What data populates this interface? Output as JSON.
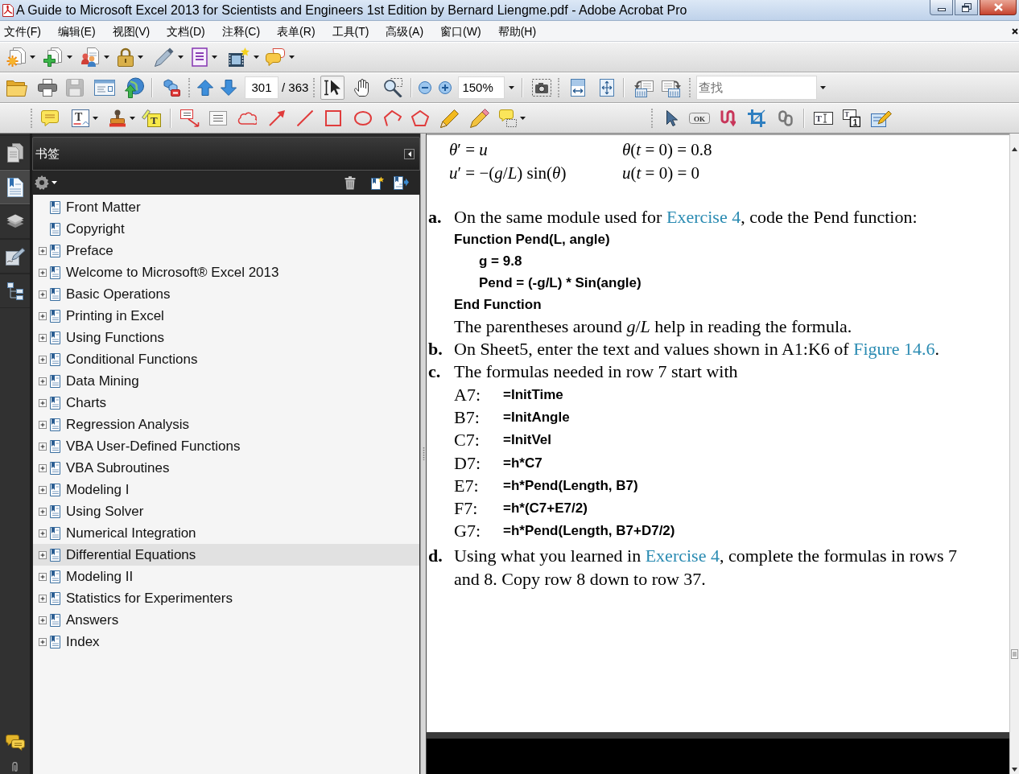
{
  "window": {
    "title": "A Guide to Microsoft Excel 2013 for Scientists and Engineers 1st Edition by Bernard Liengme.pdf - Adobe Acrobat Pro"
  },
  "menu_bar": {
    "items": [
      "文件(F)",
      "编辑(E)",
      "视图(V)",
      "文档(D)",
      "注释(C)",
      "表单(R)",
      "工具(T)",
      "高级(A)",
      "窗口(W)",
      "帮助(H)"
    ]
  },
  "task_toolbar": {
    "buttons": [
      {
        "kind": "create"
      },
      {
        "kind": "combine"
      },
      {
        "kind": "collaborate"
      },
      {
        "kind": "secure"
      },
      {
        "kind": "sign"
      },
      {
        "kind": "forms"
      },
      {
        "kind": "multimedia"
      },
      {
        "kind": "comment"
      }
    ]
  },
  "file_toolbar": {
    "buttons": [
      {
        "kind": "open",
        "disabled": false
      },
      {
        "kind": "print",
        "disabled": false
      },
      {
        "kind": "save",
        "disabled": true
      },
      {
        "kind": "email",
        "disabled": false
      },
      {
        "kind": "upload",
        "disabled": false
      }
    ]
  },
  "page_navigation": {
    "page": "301",
    "page_count": "/ 363"
  },
  "select_zoom_tools": {
    "tools": [
      {
        "kind": "select",
        "selected": true
      },
      {
        "kind": "hand",
        "selected": false
      },
      {
        "kind": "marquee_zoom",
        "selected": false
      }
    ],
    "zoom": "150%"
  },
  "search": {
    "placeholder": "查找"
  },
  "comment_toolbar": {
    "text_edits_glyph": "T",
    "highlight_glyph": "T"
  },
  "forms_toolbar": {
    "button_glyph": "OK",
    "text_field_glyph": "T",
    "list_box_glyphs": [
      "T",
      "1"
    ]
  },
  "navigation_pane": {
    "buttons": [
      {
        "kind": "pages",
        "selected": false
      },
      {
        "kind": "bookmarks",
        "selected": true
      },
      {
        "kind": "layers",
        "selected": false
      },
      {
        "kind": "signatures",
        "selected": false
      },
      {
        "kind": "model_tree",
        "selected": false
      }
    ]
  },
  "bookmarks_panel": {
    "title": "书签",
    "items": [
      {
        "label": "Front Matter",
        "expandable": false,
        "selected": false
      },
      {
        "label": "Copyright",
        "expandable": false,
        "selected": false
      },
      {
        "label": "Preface",
        "expandable": true,
        "expanded": false,
        "selected": false
      },
      {
        "label": "Welcome to Microsoft® Excel 2013",
        "expandable": true,
        "expanded": false,
        "selected": false
      },
      {
        "label": "Basic Operations",
        "expandable": true,
        "expanded": false,
        "selected": false
      },
      {
        "label": "Printing in Excel",
        "expandable": true,
        "expanded": false,
        "selected": false
      },
      {
        "label": "Using Functions",
        "expandable": true,
        "expanded": false,
        "selected": false
      },
      {
        "label": "Conditional Functions",
        "expandable": true,
        "expanded": false,
        "selected": false
      },
      {
        "label": "Data Mining",
        "expandable": true,
        "expanded": false,
        "selected": false
      },
      {
        "label": "Charts",
        "expandable": true,
        "expanded": false,
        "selected": false
      },
      {
        "label": "Regression Analysis",
        "expandable": true,
        "expanded": false,
        "selected": false
      },
      {
        "label": "VBA User-Defined Functions",
        "expandable": true,
        "expanded": false,
        "selected": false
      },
      {
        "label": "VBA Subroutines",
        "expandable": true,
        "expanded": false,
        "selected": false
      },
      {
        "label": "Modeling I",
        "expandable": true,
        "expanded": false,
        "selected": false
      },
      {
        "label": "Using Solver",
        "expandable": true,
        "expanded": false,
        "selected": false
      },
      {
        "label": "Numerical Integration",
        "expandable": true,
        "expanded": false,
        "selected": false
      },
      {
        "label": "Differential Equations",
        "expandable": true,
        "expanded": false,
        "selected": true
      },
      {
        "label": "Modeling II",
        "expandable": true,
        "expanded": false,
        "selected": false
      },
      {
        "label": "Statistics for Experimenters",
        "expandable": true,
        "expanded": false,
        "selected": false
      },
      {
        "label": "Answers",
        "expandable": true,
        "expanded": false,
        "selected": false
      },
      {
        "label": "Index",
        "expandable": true,
        "expanded": false,
        "selected": false
      }
    ]
  },
  "document": {
    "equations": [
      {
        "left": "*θ*′ = *u*",
        "right": "*θ*(*t* = 0) = 0.8"
      },
      {
        "left": "*u*′ = −(*g*/*L*) sin(*θ*)",
        "right": "*u*(*t* = 0) = 0"
      }
    ],
    "steps": [
      {
        "marker": "a.",
        "text": [
          {
            "kind": "text",
            "text": "On the same module used for "
          },
          {
            "kind": "link",
            "text": "Exercise 4"
          },
          {
            "kind": "text",
            "text": ", code the Pend function:"
          }
        ],
        "code": [
          {
            "text": "Function Pend(L, angle)",
            "children": [
              {
                "text": "g = 9.8"
              },
              {
                "text": "Pend = (-g/L) * Sin(angle)"
              }
            ]
          },
          {
            "text": "End Function"
          }
        ],
        "note": "The parentheses around *g*/*L* help in reading the formula."
      },
      {
        "marker": "b.",
        "text": [
          {
            "kind": "text",
            "text": "On Sheet5, enter the text and values shown in A1:K6 of "
          },
          {
            "kind": "link",
            "text": "Figure 14.6"
          },
          {
            "kind": "text",
            "text": "."
          }
        ]
      },
      {
        "marker": "c.",
        "text": [
          {
            "kind": "text",
            "text": "The formulas needed in row 7 start with"
          }
        ],
        "formulas": [
          {
            "cell": "A7:",
            "formula": "=InitTime"
          },
          {
            "cell": "B7:",
            "formula": "=InitAngle"
          },
          {
            "cell": "C7:",
            "formula": "=InitVel"
          },
          {
            "cell": "D7:",
            "formula": "=h*C7"
          },
          {
            "cell": "E7:",
            "formula": "=h*Pend(Length, B7)"
          },
          {
            "cell": "F7:",
            "formula": "=h*(C7+E7/2)"
          },
          {
            "cell": "G7:",
            "formula": "=h*Pend(Length, B7+D7/2)"
          }
        ]
      },
      {
        "marker": "d.",
        "text": [
          {
            "kind": "text",
            "text": "Using what you learned in "
          },
          {
            "kind": "link",
            "text": "Exercise 4"
          },
          {
            "kind": "text",
            "text": ", complete the formulas in rows 7 and 8. Copy row 8 down to row 37."
          }
        ]
      }
    ]
  }
}
